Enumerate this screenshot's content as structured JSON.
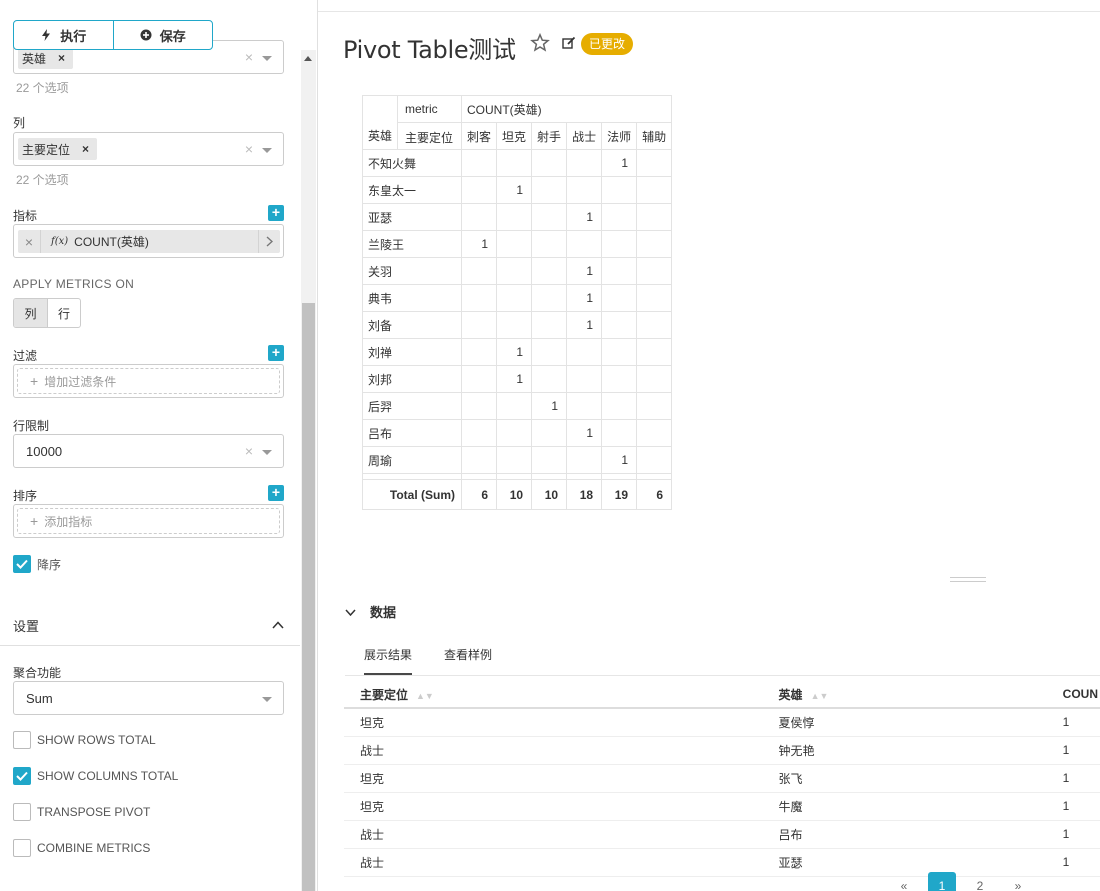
{
  "toolbar": {
    "run_label": "执行",
    "save_label": "保存"
  },
  "controls": {
    "rows_chip": "英雄",
    "rows_hint": "22 个选项",
    "columns_label": "列",
    "columns_chip": "主要定位",
    "columns_hint": "22 个选项",
    "metrics_label": "指标",
    "metric_chip": "COUNT(英雄)",
    "apply_metrics_label": "APPLY METRICS ON",
    "apply_options": [
      "列",
      "行"
    ],
    "filter_label": "过滤",
    "filter_placeholder": "增加过滤条件",
    "row_limit_label": "行限制",
    "row_limit_value": "10000",
    "sort_label": "排序",
    "sort_placeholder": "添加指标",
    "descending_label": "降序",
    "descending_checked": true,
    "settings_label": "设置",
    "agg_label": "聚合功能",
    "agg_value": "Sum",
    "checkboxes": [
      {
        "label": "SHOW ROWS TOTAL",
        "checked": false
      },
      {
        "label": "SHOW COLUMNS TOTAL",
        "checked": true
      },
      {
        "label": "TRANSPOSE PIVOT",
        "checked": false
      },
      {
        "label": "COMBINE METRICS",
        "checked": false
      }
    ]
  },
  "header": {
    "title": "Pivot Table测试",
    "badge": "已更改"
  },
  "pivot": {
    "metric_label": "metric",
    "metric_value": "COUNT(英雄)",
    "col_dim_label": "主要定位",
    "row_dim_label": "英雄",
    "columns": [
      "刺客",
      "坦克",
      "射手",
      "战士",
      "法师",
      "辅助"
    ],
    "rows": [
      {
        "name": "不知火舞",
        "cells": [
          "",
          "",
          "",
          "",
          "1",
          ""
        ]
      },
      {
        "name": "东皇太一",
        "cells": [
          "",
          "1",
          "",
          "",
          "",
          ""
        ]
      },
      {
        "name": "亚瑟",
        "cells": [
          "",
          "",
          "",
          "1",
          "",
          ""
        ]
      },
      {
        "name": "兰陵王",
        "cells": [
          "1",
          "",
          "",
          "",
          "",
          ""
        ]
      },
      {
        "name": "关羽",
        "cells": [
          "",
          "",
          "",
          "1",
          "",
          ""
        ]
      },
      {
        "name": "典韦",
        "cells": [
          "",
          "",
          "",
          "1",
          "",
          ""
        ]
      },
      {
        "name": "刘备",
        "cells": [
          "",
          "",
          "",
          "1",
          "",
          ""
        ]
      },
      {
        "name": "刘禅",
        "cells": [
          "",
          "1",
          "",
          "",
          "",
          ""
        ]
      },
      {
        "name": "刘邦",
        "cells": [
          "",
          "1",
          "",
          "",
          "",
          ""
        ]
      },
      {
        "name": "后羿",
        "cells": [
          "",
          "",
          "1",
          "",
          "",
          ""
        ]
      },
      {
        "name": "吕布",
        "cells": [
          "",
          "",
          "",
          "1",
          "",
          ""
        ]
      },
      {
        "name": "周瑜",
        "cells": [
          "",
          "",
          "",
          "",
          "1",
          ""
        ]
      }
    ],
    "total_label": "Total (Sum)",
    "totals": [
      "6",
      "10",
      "10",
      "18",
      "19",
      "6"
    ]
  },
  "data_section": {
    "title": "数据",
    "tabs": [
      "展示结果",
      "查看样例"
    ],
    "headers": [
      "主要定位",
      "英雄",
      "COUN"
    ],
    "rows": [
      [
        "坦克",
        "夏侯惇",
        "1"
      ],
      [
        "战士",
        "钟无艳",
        "1"
      ],
      [
        "坦克",
        "张飞",
        "1"
      ],
      [
        "坦克",
        "牛魔",
        "1"
      ],
      [
        "战士",
        "吕布",
        "1"
      ],
      [
        "战士",
        "亚瑟",
        "1"
      ]
    ]
  },
  "pagination": {
    "prev": "«",
    "pages": [
      "1",
      "2"
    ],
    "next": "»"
  }
}
